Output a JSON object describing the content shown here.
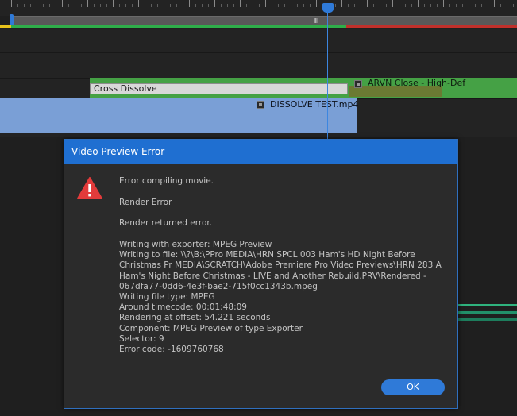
{
  "timeline": {
    "transition_label": "Cross Dissolve",
    "clip_green_label": "ARVN Close - High-Def",
    "clip_blue_label": "DISSOLVE TEST.mp4",
    "work_area_grip": "III",
    "colors": {
      "accent": "#2f7ad8",
      "render_green": "#2fae4a",
      "render_red": "#c0302b",
      "render_yellow": "#e8c21b"
    }
  },
  "dialog": {
    "title": "Video Preview Error",
    "icon": "warning-icon",
    "line1": "Error compiling movie.",
    "line2": "Render Error",
    "line3": "Render returned error.",
    "details": [
      "Writing with exporter: MPEG Preview",
      "Writing to file: \\\\?\\B:\\PPro MEDIA\\HRN SPCL 003 Ham's HD Night Before",
      "Christmas Pr MEDIA\\SCRATCH\\Adobe Premiere Pro Video Previews\\HRN 283 A",
      "Ham's Night Before Christmas - LIVE and Another Rebuild.PRV\\Rendered -",
      "067dfa77-0dd6-4e3f-bae2-715f0cc1343b.mpeg",
      "Writing file type: MPEG",
      "Around timecode: 00:01:48:09",
      "Rendering at offset: 54.221 seconds",
      "Component: MPEG Preview of type Exporter",
      "Selector: 9",
      "Error code: -1609760768"
    ],
    "ok_label": "OK"
  }
}
